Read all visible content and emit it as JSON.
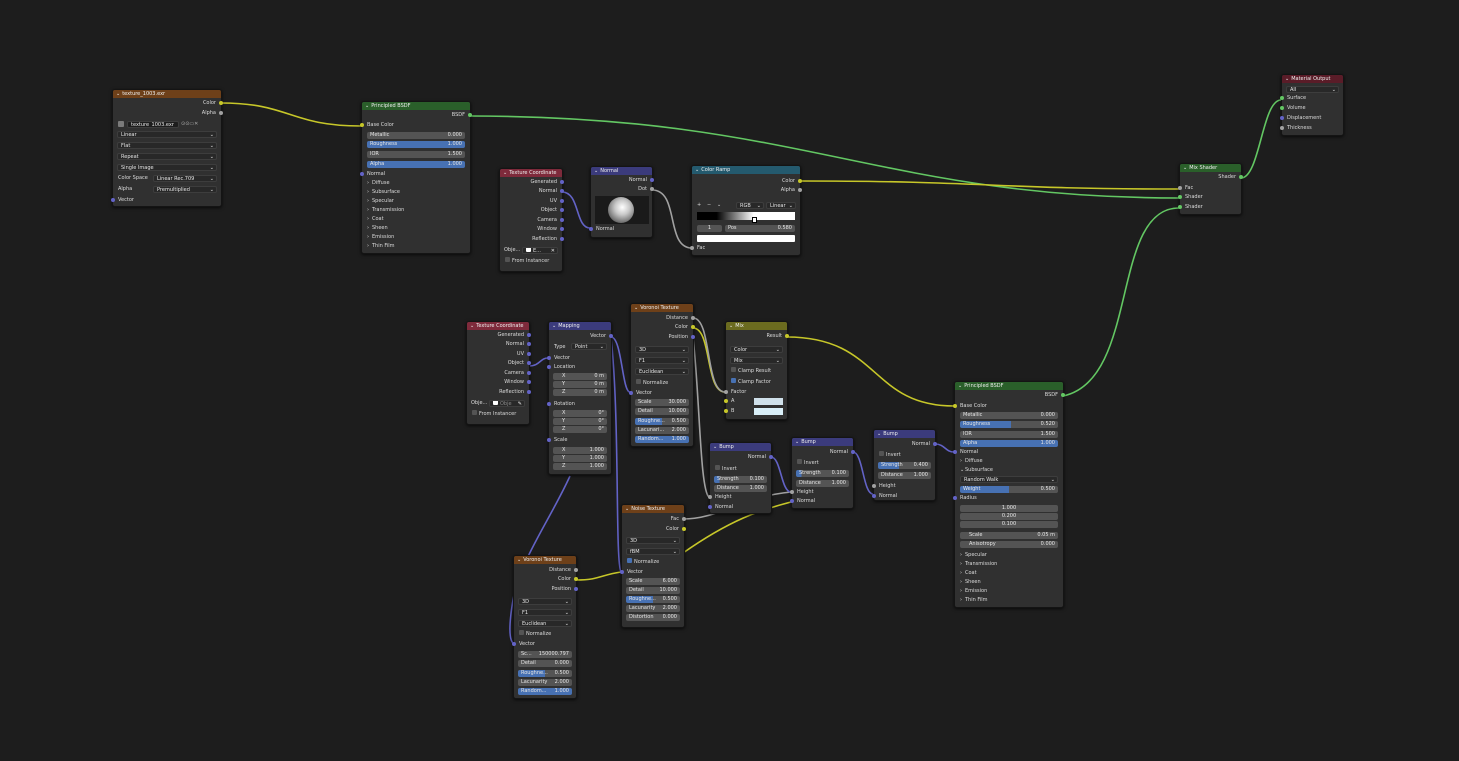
{
  "nodes": {
    "image_texture": {
      "title": "texture_1003.exr",
      "outputs": [
        "Color",
        "Alpha"
      ],
      "image_name": "texture_1003.exr",
      "interpolation": "Linear",
      "projection": "Flat",
      "extension": "Repeat",
      "source": "Single Image",
      "color_space_label": "Color Space",
      "color_space": "Linear Rec.709",
      "alpha_label": "Alpha",
      "alpha_mode": "Premultiplied",
      "input_vector": "Vector"
    },
    "principled_1": {
      "title": "Principled BSDF",
      "output": "BSDF",
      "base_color": "Base Color",
      "metallic": {
        "label": "Metallic",
        "value": "0.000"
      },
      "roughness": {
        "label": "Roughness",
        "value": "1.000"
      },
      "ior": {
        "label": "IOR",
        "value": "1.500"
      },
      "alpha": {
        "label": "Alpha",
        "value": "1.000"
      },
      "normal": "Normal",
      "panels": [
        "Diffuse",
        "Subsurface",
        "Specular",
        "Transmission",
        "Coat",
        "Sheen",
        "Emission",
        "Thin Film"
      ]
    },
    "texcoord_1": {
      "title": "Texture Coordinate",
      "outputs": [
        "Generated",
        "Normal",
        "UV",
        "Object",
        "Camera",
        "Window",
        "Reflection"
      ],
      "object_label": "Obje...",
      "object_value": "E...",
      "from_instancer": "From Instancer"
    },
    "normal_node": {
      "title": "Normal",
      "outputs": [
        "Normal",
        "Dot"
      ],
      "input": "Normal"
    },
    "color_ramp": {
      "title": "Color Ramp",
      "outputs": [
        "Color",
        "Alpha"
      ],
      "mode": "RGB",
      "interp": "Linear",
      "index": "1",
      "pos_label": "Pos",
      "pos_value": "0.580",
      "input": "Fac"
    },
    "mix_shader": {
      "title": "Mix Shader",
      "output": "Shader",
      "inputs": [
        "Fac",
        "Shader",
        "Shader"
      ]
    },
    "material_output": {
      "title": "Material Output",
      "target": "All",
      "inputs": [
        "Surface",
        "Volume",
        "Displacement",
        "Thickness"
      ]
    },
    "texcoord_2": {
      "title": "Texture Coordinate",
      "outputs": [
        "Generated",
        "Normal",
        "UV",
        "Object",
        "Camera",
        "Window",
        "Reflection"
      ],
      "object_label": "Obje...",
      "object_value": "Obje",
      "from_instancer": "From Instancer"
    },
    "mapping": {
      "title": "Mapping",
      "output": "Vector",
      "type_label": "Type",
      "type_value": "Point",
      "vector": "Vector",
      "location": "Location",
      "loc": [
        {
          "a": "X",
          "v": "0 m"
        },
        {
          "a": "Y",
          "v": "0 m"
        },
        {
          "a": "Z",
          "v": "0 m"
        }
      ],
      "rotation": "Rotation",
      "rot": [
        {
          "a": "X",
          "v": "0°"
        },
        {
          "a": "Y",
          "v": "0°"
        },
        {
          "a": "Z",
          "v": "0°"
        }
      ],
      "scale": "Scale",
      "scl": [
        {
          "a": "X",
          "v": "1.000"
        },
        {
          "a": "Y",
          "v": "1.000"
        },
        {
          "a": "Z",
          "v": "1.000"
        }
      ]
    },
    "voronoi_1": {
      "title": "Voronoi Texture",
      "outputs": [
        "Distance",
        "Color",
        "Position"
      ],
      "dim": "3D",
      "feature": "F1",
      "metric": "Euclidean",
      "normalize": "Normalize",
      "vector": "Vector",
      "fields": [
        {
          "label": "Scale",
          "value": "30.000"
        },
        {
          "label": "Detail",
          "value": "10.000"
        },
        {
          "label": "Roughne...",
          "value": "0.500"
        },
        {
          "label": "Lacunari...",
          "value": "2.000"
        },
        {
          "label": "Random...",
          "value": "1.000"
        }
      ]
    },
    "mix": {
      "title": "Mix",
      "output": "Result",
      "data_type": "Color",
      "blend": "Mix",
      "clamp_result": "Clamp Result",
      "clamp_factor": "Clamp Factor",
      "factor": "Factor",
      "a": "A",
      "b": "B"
    },
    "bump_1": {
      "title": "Bump",
      "output": "Normal",
      "invert": "Invert",
      "strength": {
        "label": "Strength",
        "value": "0.100"
      },
      "distance": {
        "label": "Distance",
        "value": "1.000"
      },
      "height": "Height",
      "normal": "Normal"
    },
    "bump_2": {
      "title": "Bump",
      "output": "Normal",
      "invert": "Invert",
      "strength": {
        "label": "Strength",
        "value": "0.100"
      },
      "distance": {
        "label": "Distance",
        "value": "1.000"
      },
      "height": "Height",
      "normal": "Normal"
    },
    "bump_3": {
      "title": "Bump",
      "output": "Normal",
      "invert": "Invert",
      "strength": {
        "label": "Strength",
        "value": "0.400"
      },
      "distance": {
        "label": "Distance",
        "value": "1.000"
      },
      "height": "Height",
      "normal": "Normal"
    },
    "noise": {
      "title": "Noise Texture",
      "outputs": [
        "Fac",
        "Color"
      ],
      "dim": "3D",
      "type": "fBM",
      "normalize": "Normalize",
      "vector": "Vector",
      "fields": [
        {
          "label": "Scale",
          "value": "6.000"
        },
        {
          "label": "Detail",
          "value": "10.000"
        },
        {
          "label": "Roughne...",
          "value": "0.500"
        },
        {
          "label": "Lacunarity",
          "value": "2.000"
        },
        {
          "label": "Distortion",
          "value": "0.000"
        }
      ]
    },
    "voronoi_2": {
      "title": "Voronoi Texture",
      "outputs": [
        "Distance",
        "Color",
        "Position"
      ],
      "dim": "3D",
      "feature": "F1",
      "metric": "Euclidean",
      "normalize": "Normalize",
      "vector": "Vector",
      "fields": [
        {
          "label": "Sc...",
          "value": "150000.797"
        },
        {
          "label": "Detail",
          "value": "0.000"
        },
        {
          "label": "Roughne...",
          "value": "0.500"
        },
        {
          "label": "Lacunarity",
          "value": "2.000"
        },
        {
          "label": "Random...",
          "value": "1.000"
        }
      ]
    },
    "principled_2": {
      "title": "Principled BSDF",
      "output": "BSDF",
      "base_color": "Base Color",
      "metallic": {
        "label": "Metallic",
        "value": "0.000"
      },
      "roughness": {
        "label": "Roughness",
        "value": "0.520"
      },
      "ior": {
        "label": "IOR",
        "value": "1.500"
      },
      "alpha": {
        "label": "Alpha",
        "value": "1.000"
      },
      "normal": "Normal",
      "diffuse": "Diffuse",
      "subsurface": "Subsurface",
      "sss_method": "Random Walk",
      "weight": {
        "label": "Weight",
        "value": "0.500"
      },
      "radius": "Radius",
      "radius_values": [
        "1.000",
        "0.200",
        "0.100"
      ],
      "scale": {
        "label": "Scale",
        "value": "0.05 m"
      },
      "anisotropy": {
        "label": "Anisotropy",
        "value": "0.000"
      },
      "panels": [
        "Specular",
        "Transmission",
        "Coat",
        "Sheen",
        "Emission",
        "Thin Film"
      ]
    }
  },
  "colors": {
    "background": "#1d1d1d",
    "node_body": "#303030",
    "texture_header": "#6e4019",
    "shader_header": "#2a5f2a",
    "input_header": "#7e2a3b",
    "vector_header": "#3b3b7c",
    "converter_header": "#245a6e",
    "color_header": "#6b6b1f",
    "output_header": "#5a1c28",
    "socket_color": "#c7c729",
    "socket_float": "#a1a1a1",
    "socket_vector": "#6363c7",
    "socket_shader": "#63c763",
    "slider_blue": "#4771b3"
  }
}
